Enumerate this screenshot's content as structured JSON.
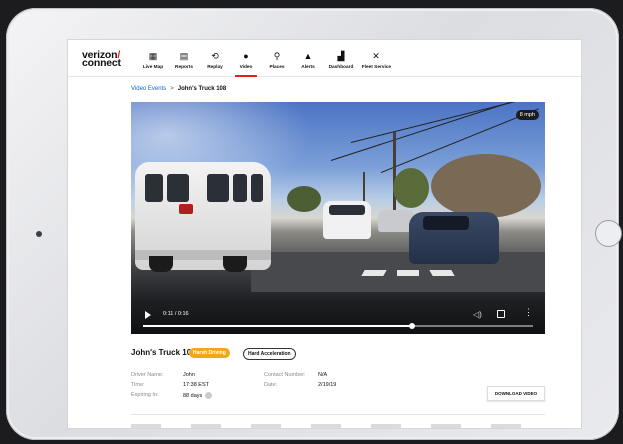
{
  "app": {
    "brand_line1": "verizon",
    "brand_slash": "/",
    "brand_line2": "connect"
  },
  "nav": [
    {
      "label": "Live Map",
      "icon": "live-map-icon",
      "glyph": "▦"
    },
    {
      "label": "Reports",
      "icon": "reports-icon",
      "glyph": "▤"
    },
    {
      "label": "Replay",
      "icon": "replay-icon",
      "glyph": "⟲"
    },
    {
      "label": "Video",
      "icon": "video-icon",
      "glyph": "●",
      "active": true
    },
    {
      "label": "Places",
      "icon": "places-icon",
      "glyph": "⚲"
    },
    {
      "label": "Alerts",
      "icon": "alerts-icon",
      "glyph": "▲"
    },
    {
      "label": "Dashboard",
      "icon": "dashboard-icon",
      "glyph": "▟"
    },
    {
      "label": "Fleet Service",
      "icon": "fleet-service-icon",
      "glyph": "✕"
    }
  ],
  "breadcrumb": {
    "parent": "Video Events",
    "separator": ">",
    "current": "John's Truck 108"
  },
  "video": {
    "speed_overlay": "8 mph",
    "time": "0:11 / 0:16",
    "progress": 0.69
  },
  "event": {
    "title": "John's Truck 108",
    "badges": [
      "Harsh Driving",
      "Hard Acceleration"
    ],
    "fields": {
      "driver_name_label": "Driver Name:",
      "driver_name": "John",
      "time_label": "Time:",
      "time": "17:38 EST",
      "expiring_label": "Expiring In:",
      "expiring": "88 days",
      "contact_label": "Contact Number:",
      "contact": "N/A",
      "date_label": "Date:",
      "date": "2/19/19"
    },
    "download_label": "DOWNLOAD VIDEO"
  },
  "colors": {
    "accent": "#e2231a",
    "badge_harsh": "#f0a818",
    "link": "#1565c0"
  }
}
